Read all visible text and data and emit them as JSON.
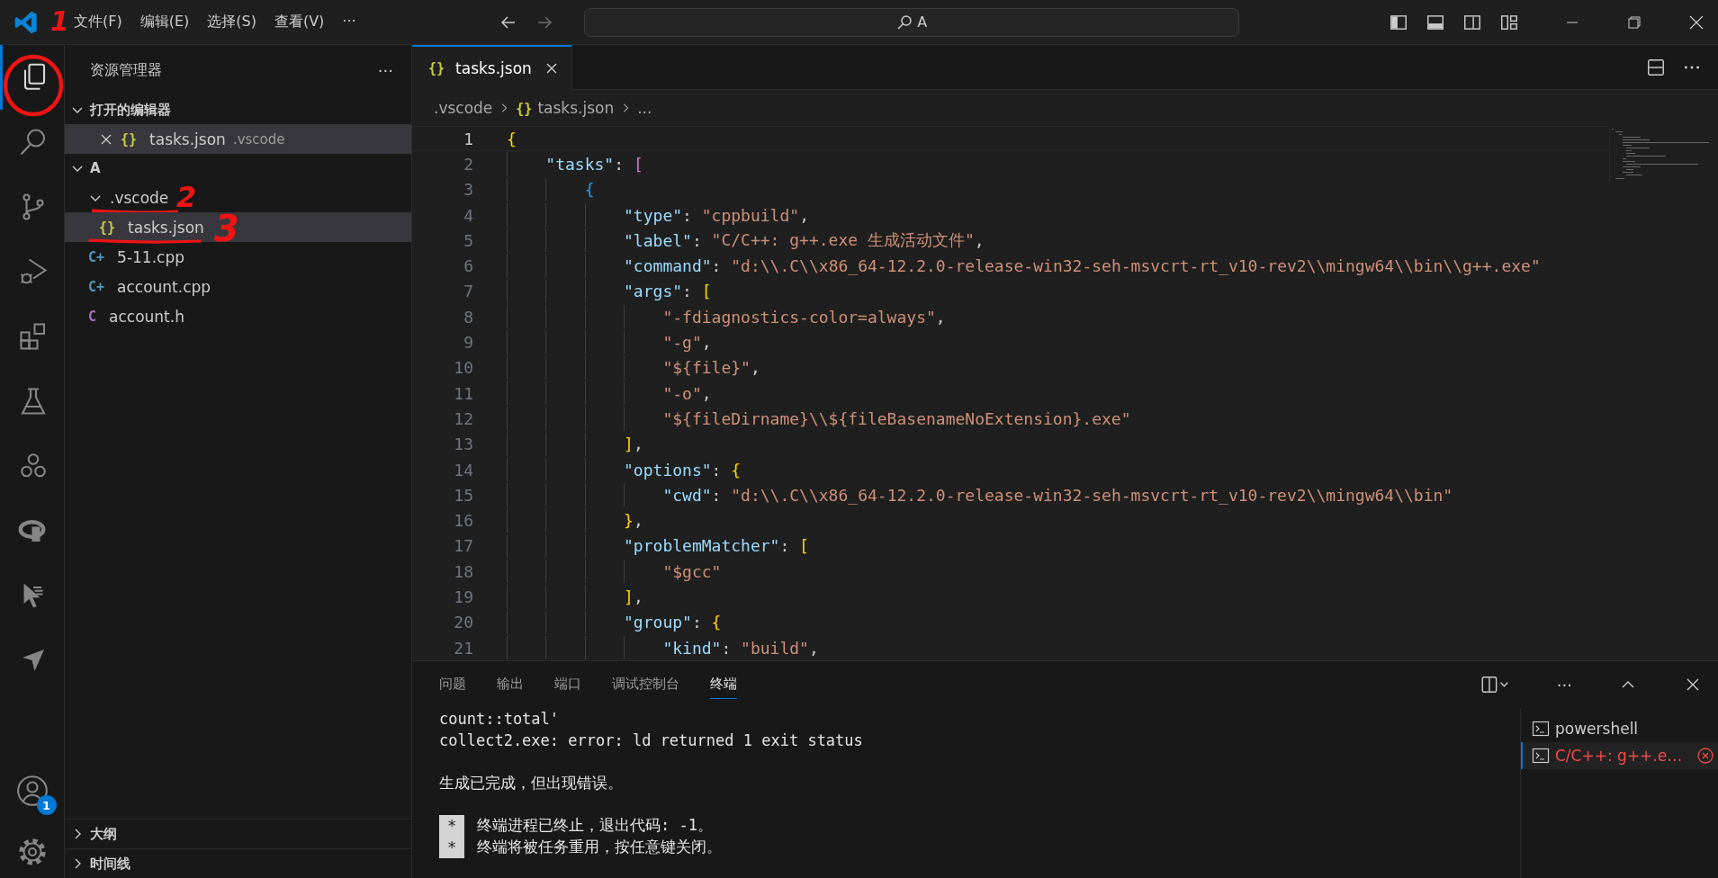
{
  "title_bar": {
    "menus": [
      "文件(F)",
      "编辑(E)",
      "选择(S)",
      "查看(V)"
    ],
    "more": "···",
    "search": {
      "value": "A"
    }
  },
  "activity_bar": {
    "items": [
      {
        "kind": "files",
        "selected": true
      },
      {
        "kind": "search",
        "selected": false
      },
      {
        "kind": "branch",
        "selected": false
      },
      {
        "kind": "run_debug",
        "selected": false
      },
      {
        "kind": "extensions",
        "selected": false
      },
      {
        "kind": "testing",
        "selected": false
      },
      {
        "kind": "circles",
        "selected": false
      },
      {
        "kind": "ring",
        "selected": false
      },
      {
        "kind": "cursor",
        "selected": false
      },
      {
        "kind": "send",
        "selected": false
      }
    ],
    "accounts_badge": "1"
  },
  "sidebar": {
    "title": "资源管理器",
    "more": "···",
    "open_editors": {
      "title": "打开的编辑器",
      "expanded": true,
      "items": [
        {
          "name": "tasks.json",
          "folder": ".vscode",
          "icon": "{}",
          "color": "#cbcb41",
          "selected": true
        }
      ]
    },
    "folder": {
      "title": "A",
      "expanded": true,
      "tree": [
        {
          "name": ".vscode",
          "kind": "folder",
          "expanded": true,
          "selected": false,
          "annotation": "2",
          "children": [
            {
              "name": "tasks.json",
              "icon": "{}",
              "color": "#cbcb41",
              "selected": true,
              "annotation": "3"
            }
          ]
        },
        {
          "name": "5-11.cpp",
          "kind": "file",
          "icon": "C+",
          "color": "#519aba",
          "selected": false
        },
        {
          "name": "account.cpp",
          "kind": "file",
          "icon": "C+",
          "color": "#519aba",
          "selected": false
        },
        {
          "name": "account.h",
          "kind": "file",
          "icon": "C",
          "color": "#a074c4",
          "selected": false
        }
      ]
    },
    "bottom_sections": [
      {
        "title": "大纲",
        "expanded": false
      },
      {
        "title": "时间线",
        "expanded": false
      }
    ]
  },
  "editor": {
    "tabs": [
      {
        "label": "tasks.json",
        "icon": "{}",
        "selected": true
      }
    ],
    "breadcrumb": [
      {
        "text": ".vscode"
      },
      {
        "text": "tasks.json",
        "icon": "{}"
      },
      {
        "text": "..."
      }
    ],
    "lines": [
      {
        "number": "1",
        "current": true,
        "tokens": [
          {
            "kind": "open",
            "text": "{"
          }
        ]
      },
      {
        "number": "2",
        "current": false,
        "tokens": [
          {
            "kind": "key",
            "text": "\"tasks\""
          },
          {
            "kind": "punc",
            "text": ": "
          },
          {
            "kind": "open",
            "text": "["
          }
        ]
      },
      {
        "number": "3",
        "current": false,
        "tokens": [
          {
            "kind": "open",
            "text": "{"
          }
        ]
      },
      {
        "number": "4",
        "current": false,
        "tokens": [
          {
            "kind": "key",
            "text": "\"type\""
          },
          {
            "kind": "punc",
            "text": ": "
          },
          {
            "kind": "str",
            "text": "\"cppbuild\""
          },
          {
            "kind": "punc",
            "text": ","
          }
        ]
      },
      {
        "number": "5",
        "current": false,
        "tokens": [
          {
            "kind": "key",
            "text": "\"label\""
          },
          {
            "kind": "punc",
            "text": ": "
          },
          {
            "kind": "str",
            "text": "\"C/C++: g++.exe 生成活动文件\""
          },
          {
            "kind": "punc",
            "text": ","
          }
        ]
      },
      {
        "number": "6",
        "current": false,
        "tokens": [
          {
            "kind": "key",
            "text": "\"command\""
          },
          {
            "kind": "punc",
            "text": ": "
          },
          {
            "kind": "str",
            "text": "\"d:\\\\.C\\\\x86_64-12.2.0-release-win32-seh-msvcrt-rt_v10-rev2\\\\mingw64\\\\bin\\\\g++.exe\""
          }
        ]
      },
      {
        "number": "7",
        "current": false,
        "tokens": [
          {
            "kind": "key",
            "text": "\"args\""
          },
          {
            "kind": "punc",
            "text": ": "
          },
          {
            "kind": "open",
            "text": "["
          }
        ]
      },
      {
        "number": "8",
        "current": false,
        "tokens": [
          {
            "kind": "str",
            "text": "\"-fdiagnostics-color=always\""
          },
          {
            "kind": "punc",
            "text": ","
          }
        ]
      },
      {
        "number": "9",
        "current": false,
        "tokens": [
          {
            "kind": "str",
            "text": "\"-g\""
          },
          {
            "kind": "punc",
            "text": ","
          }
        ]
      },
      {
        "number": "10",
        "current": false,
        "tokens": [
          {
            "kind": "str",
            "text": "\"${file}\""
          },
          {
            "kind": "punc",
            "text": ","
          }
        ]
      },
      {
        "number": "11",
        "current": false,
        "tokens": [
          {
            "kind": "str",
            "text": "\"-o\""
          },
          {
            "kind": "punc",
            "text": ","
          }
        ]
      },
      {
        "number": "12",
        "current": false,
        "tokens": [
          {
            "kind": "str",
            "text": "\"${fileDirname}\\\\${fileBasenameNoExtension}.exe\""
          }
        ]
      },
      {
        "number": "13",
        "current": false,
        "tokens": [
          {
            "kind": "close",
            "text": "]"
          },
          {
            "kind": "punc",
            "text": ","
          }
        ]
      },
      {
        "number": "14",
        "current": false,
        "tokens": [
          {
            "kind": "key",
            "text": "\"options\""
          },
          {
            "kind": "punc",
            "text": ": "
          },
          {
            "kind": "open",
            "text": "{"
          }
        ]
      },
      {
        "number": "15",
        "current": false,
        "tokens": [
          {
            "kind": "key",
            "text": "\"cwd\""
          },
          {
            "kind": "punc",
            "text": ": "
          },
          {
            "kind": "str",
            "text": "\"d:\\\\.C\\\\x86_64-12.2.0-release-win32-seh-msvcrt-rt_v10-rev2\\\\mingw64\\\\bin\""
          }
        ]
      },
      {
        "number": "16",
        "current": false,
        "tokens": [
          {
            "kind": "close",
            "text": "}"
          },
          {
            "kind": "punc",
            "text": ","
          }
        ]
      },
      {
        "number": "17",
        "current": false,
        "tokens": [
          {
            "kind": "key",
            "text": "\"problemMatcher\""
          },
          {
            "kind": "punc",
            "text": ": "
          },
          {
            "kind": "open",
            "text": "["
          }
        ]
      },
      {
        "number": "18",
        "current": false,
        "tokens": [
          {
            "kind": "str",
            "text": "\"$gcc\""
          }
        ]
      },
      {
        "number": "19",
        "current": false,
        "tokens": [
          {
            "kind": "close",
            "text": "]"
          },
          {
            "kind": "punc",
            "text": ","
          }
        ]
      },
      {
        "number": "20",
        "current": false,
        "tokens": [
          {
            "kind": "key",
            "text": "\"group\""
          },
          {
            "kind": "punc",
            "text": ": "
          },
          {
            "kind": "open",
            "text": "{"
          }
        ]
      },
      {
        "number": "21",
        "current": false,
        "tokens": [
          {
            "kind": "key",
            "text": "\"kind\""
          },
          {
            "kind": "punc",
            "text": ": "
          },
          {
            "kind": "str",
            "text": "\"build\""
          },
          {
            "kind": "punc",
            "text": ","
          }
        ]
      }
    ]
  },
  "panel": {
    "tabs": [
      {
        "label": "问题",
        "selected": false
      },
      {
        "label": "输出",
        "selected": false
      },
      {
        "label": "端口",
        "selected": false
      },
      {
        "label": "调试控制台",
        "selected": false
      },
      {
        "label": "终端",
        "selected": true
      }
    ],
    "more": "···",
    "terminal_lines": [
      {
        "kind": "text",
        "text": "count::total'"
      },
      {
        "kind": "text",
        "text": "collect2.exe: error: ld returned 1 exit status"
      },
      {
        "kind": "blank"
      },
      {
        "kind": "text",
        "text": "生成已完成，但出现错误。"
      },
      {
        "kind": "blank"
      },
      {
        "kind": "notice",
        "mark": "*",
        "text": "终端进程已终止，退出代码: -1。"
      },
      {
        "kind": "notice",
        "mark": "*",
        "text": "终端将被任务重用，按任意键关闭。"
      }
    ],
    "terminals": [
      {
        "name": "powershell",
        "selected": false,
        "error": false
      },
      {
        "name": "C/C++: g++.e…",
        "selected": true,
        "error": true
      }
    ]
  },
  "annotations": [
    {
      "kind": "circle"
    },
    {
      "kind": "digit",
      "text": "1"
    }
  ]
}
